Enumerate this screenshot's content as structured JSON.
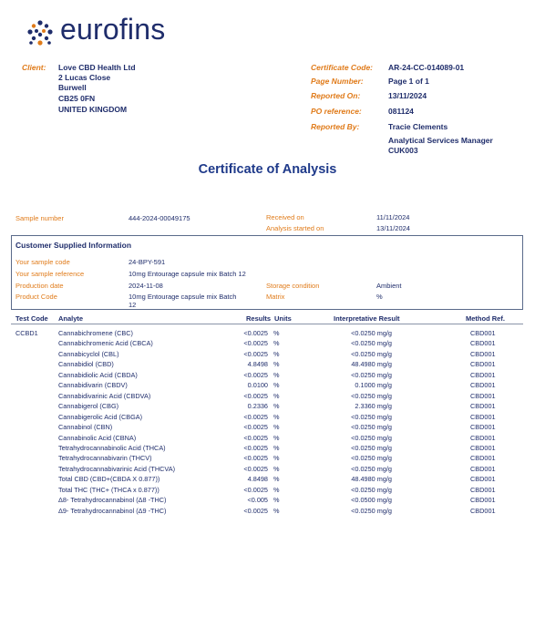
{
  "brand": {
    "name": "eurofins"
  },
  "client": {
    "label": "Client:",
    "lines": [
      "Love CBD Health Ltd",
      "2 Lucas Close",
      "Burwell",
      "CB25 0FN",
      "UNITED KINGDOM"
    ]
  },
  "meta": [
    {
      "label": "Certificate Code:",
      "value": "AR-24-CC-014089-01"
    },
    {
      "label": "Page Number:",
      "value": "Page 1 of 1"
    },
    {
      "label": "Reported On:",
      "value": "13/11/2024"
    },
    {
      "label": "PO reference:",
      "value": "081124"
    },
    {
      "label": "Reported By:",
      "value": "Tracie Clements",
      "extra": [
        "Analytical Services Manager",
        "CUK003"
      ]
    }
  ],
  "title": "Certificate of Analysis",
  "sample": {
    "number_label": "Sample number",
    "number": "444-2024-00049175",
    "received_label": "Received on",
    "received": "11/11/2024",
    "started_label": "Analysis started on",
    "started": "13/11/2024"
  },
  "csi": {
    "title": "Customer Supplied Information",
    "sample_code_label": "Your sample code",
    "sample_code": "24-BPY-591",
    "sample_ref_label": "Your sample reference",
    "sample_ref": "10mg Entourage capsule mix Batch 12",
    "production_label": "Production date",
    "production": "2024-11-08",
    "storage_label": "Storage condition",
    "storage": "Ambient",
    "product_code_label": "Product Code",
    "product_code_1": "10mg Entourage capsule mix Batch",
    "product_code_2": "12",
    "matrix_label": "Matrix",
    "matrix": "%"
  },
  "table": {
    "headers": {
      "test_code": "Test Code",
      "analyte": "Analyte",
      "results": "Results",
      "units": "Units",
      "interp": "Interpretative Result",
      "method": "Method Ref."
    },
    "test_code": "CCBD1",
    "rows": [
      {
        "analyte": "Cannabichromene (CBC)",
        "result": "<0.0025",
        "unit": "%",
        "interp": "<0.0250 mg/g",
        "method": "CBD001"
      },
      {
        "analyte": "Cannabichromenic Acid (CBCA)",
        "result": "<0.0025",
        "unit": "%",
        "interp": "<0.0250 mg/g",
        "method": "CBD001"
      },
      {
        "analyte": "Cannabicyclol (CBL)",
        "result": "<0.0025",
        "unit": "%",
        "interp": "<0.0250 mg/g",
        "method": "CBD001"
      },
      {
        "analyte": "Cannabidiol (CBD)",
        "result": "4.8498",
        "unit": "%",
        "interp": "48.4980 mg/g",
        "method": "CBD001"
      },
      {
        "analyte": "Cannabidiolic Acid (CBDA)",
        "result": "<0.0025",
        "unit": "%",
        "interp": "<0.0250 mg/g",
        "method": "CBD001"
      },
      {
        "analyte": "Cannabidivarin (CBDV)",
        "result": "0.0100",
        "unit": "%",
        "interp": "0.1000 mg/g",
        "method": "CBD001"
      },
      {
        "analyte": "Cannabidivarinic Acid (CBDVA)",
        "result": "<0.0025",
        "unit": "%",
        "interp": "<0.0250 mg/g",
        "method": "CBD001"
      },
      {
        "analyte": "Cannabigerol (CBG)",
        "result": "0.2336",
        "unit": "%",
        "interp": "2.3360 mg/g",
        "method": "CBD001"
      },
      {
        "analyte": "Cannabigerolic Acid (CBGA)",
        "result": "<0.0025",
        "unit": "%",
        "interp": "<0.0250 mg/g",
        "method": "CBD001"
      },
      {
        "analyte": "Cannabinol (CBN)",
        "result": "<0.0025",
        "unit": "%",
        "interp": "<0.0250 mg/g",
        "method": "CBD001"
      },
      {
        "analyte": "Cannabinolic Acid (CBNA)",
        "result": "<0.0025",
        "unit": "%",
        "interp": "<0.0250 mg/g",
        "method": "CBD001"
      },
      {
        "analyte": "Tetrahydrocannabinolic Acid (THCA)",
        "result": "<0.0025",
        "unit": "%",
        "interp": "<0.0250 mg/g",
        "method": "CBD001"
      },
      {
        "analyte": "Tetrahydrocannabivarin (THCV)",
        "result": "<0.0025",
        "unit": "%",
        "interp": "<0.0250 mg/g",
        "method": "CBD001"
      },
      {
        "analyte": "Tetrahydrocannabivarinic Acid (THCVA)",
        "result": "<0.0025",
        "unit": "%",
        "interp": "<0.0250 mg/g",
        "method": "CBD001"
      },
      {
        "analyte": "Total CBD (CBD+(CBDA X 0.877))",
        "result": "4.8498",
        "unit": "%",
        "interp": "48.4980 mg/g",
        "method": "CBD001"
      },
      {
        "analyte": "Total THC (THC+ (THCA x 0.877))",
        "result": "<0.0025",
        "unit": "%",
        "interp": "<0.0250 mg/g",
        "method": "CBD001"
      },
      {
        "analyte": "Δ8- Tetrahydrocannabinol (Δ8 -THC)",
        "result": "<0.005",
        "unit": "%",
        "interp": "<0.0500 mg/g",
        "method": "CBD001"
      },
      {
        "analyte": "Δ9- Tetrahydrocannabinol (Δ9 -THC)",
        "result": "<0.0025",
        "unit": "%",
        "interp": "<0.0250 mg/g",
        "method": "CBD001"
      }
    ]
  }
}
